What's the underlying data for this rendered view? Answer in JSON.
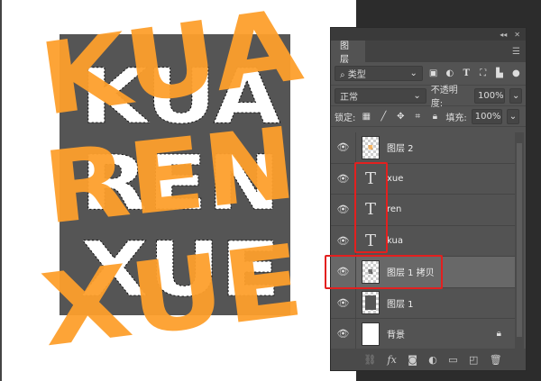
{
  "artwork": {
    "line1": "KUA",
    "line2": "REN",
    "line3": "XUE",
    "accent": "#fd9f2c",
    "canvas_gray": "#555555"
  },
  "panel": {
    "tab": "图层",
    "filter": {
      "label": "类型",
      "icons": [
        "image-icon",
        "adjustment-icon",
        "type-icon",
        "shape-icon",
        "smart-object-icon"
      ]
    },
    "blend_mode": "正常",
    "opacity_label": "不透明度:",
    "opacity": "100%",
    "lock_label": "锁定:",
    "fill_label": "填充:",
    "fill": "100%",
    "layers": [
      {
        "name": "图层 2",
        "type": "pixel"
      },
      {
        "name": "xue",
        "type": "text"
      },
      {
        "name": "ren",
        "type": "text"
      },
      {
        "name": "kua",
        "type": "text"
      },
      {
        "name": "图层 1 拷贝",
        "type": "pixel",
        "selected": true
      },
      {
        "name": "图层 1",
        "type": "pixel"
      },
      {
        "name": "背景",
        "type": "background",
        "locked": true
      }
    ],
    "footer": {
      "fx": "fx"
    }
  }
}
